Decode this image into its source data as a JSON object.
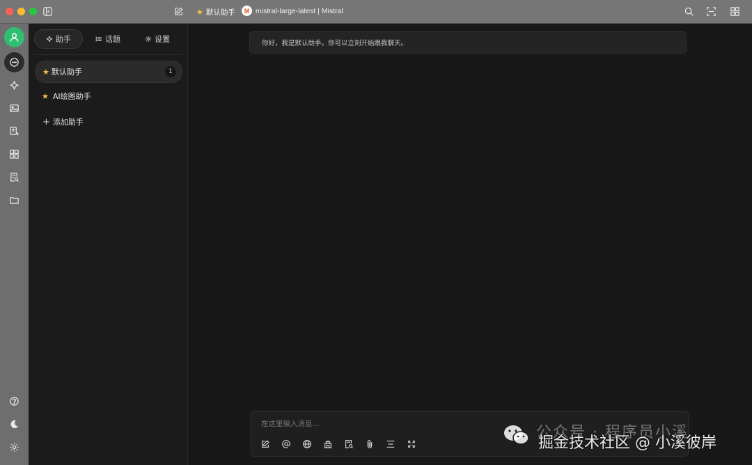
{
  "titlebar": {
    "assistant_title": "默认助手",
    "model_label": "mistral-large-latest | Mistral",
    "model_logo_letter": "M"
  },
  "sidebar": {
    "tabs": [
      {
        "label": "助手",
        "icon": "sparkle-icon",
        "active": true
      },
      {
        "label": "话题",
        "icon": "list-icon",
        "active": false
      },
      {
        "label": "设置",
        "icon": "gear-icon",
        "active": false
      }
    ],
    "assistants": [
      {
        "label": "默认助手",
        "badge": "1",
        "active": true
      },
      {
        "label": "AI绘图助手",
        "active": false
      }
    ],
    "add_label": "添加助手"
  },
  "main": {
    "greeting": "你好，我是默认助手。你可以立刻开始跟我聊天。",
    "composer_placeholder": "在这里输入消息..."
  },
  "watermark": {
    "line1": "公众号 · 程序员小溪",
    "line2": "掘金技术社区 @ 小溪彼岸"
  },
  "colors": {
    "accent": "#2fbf71",
    "star": "#f5c542",
    "background": "#181818"
  }
}
